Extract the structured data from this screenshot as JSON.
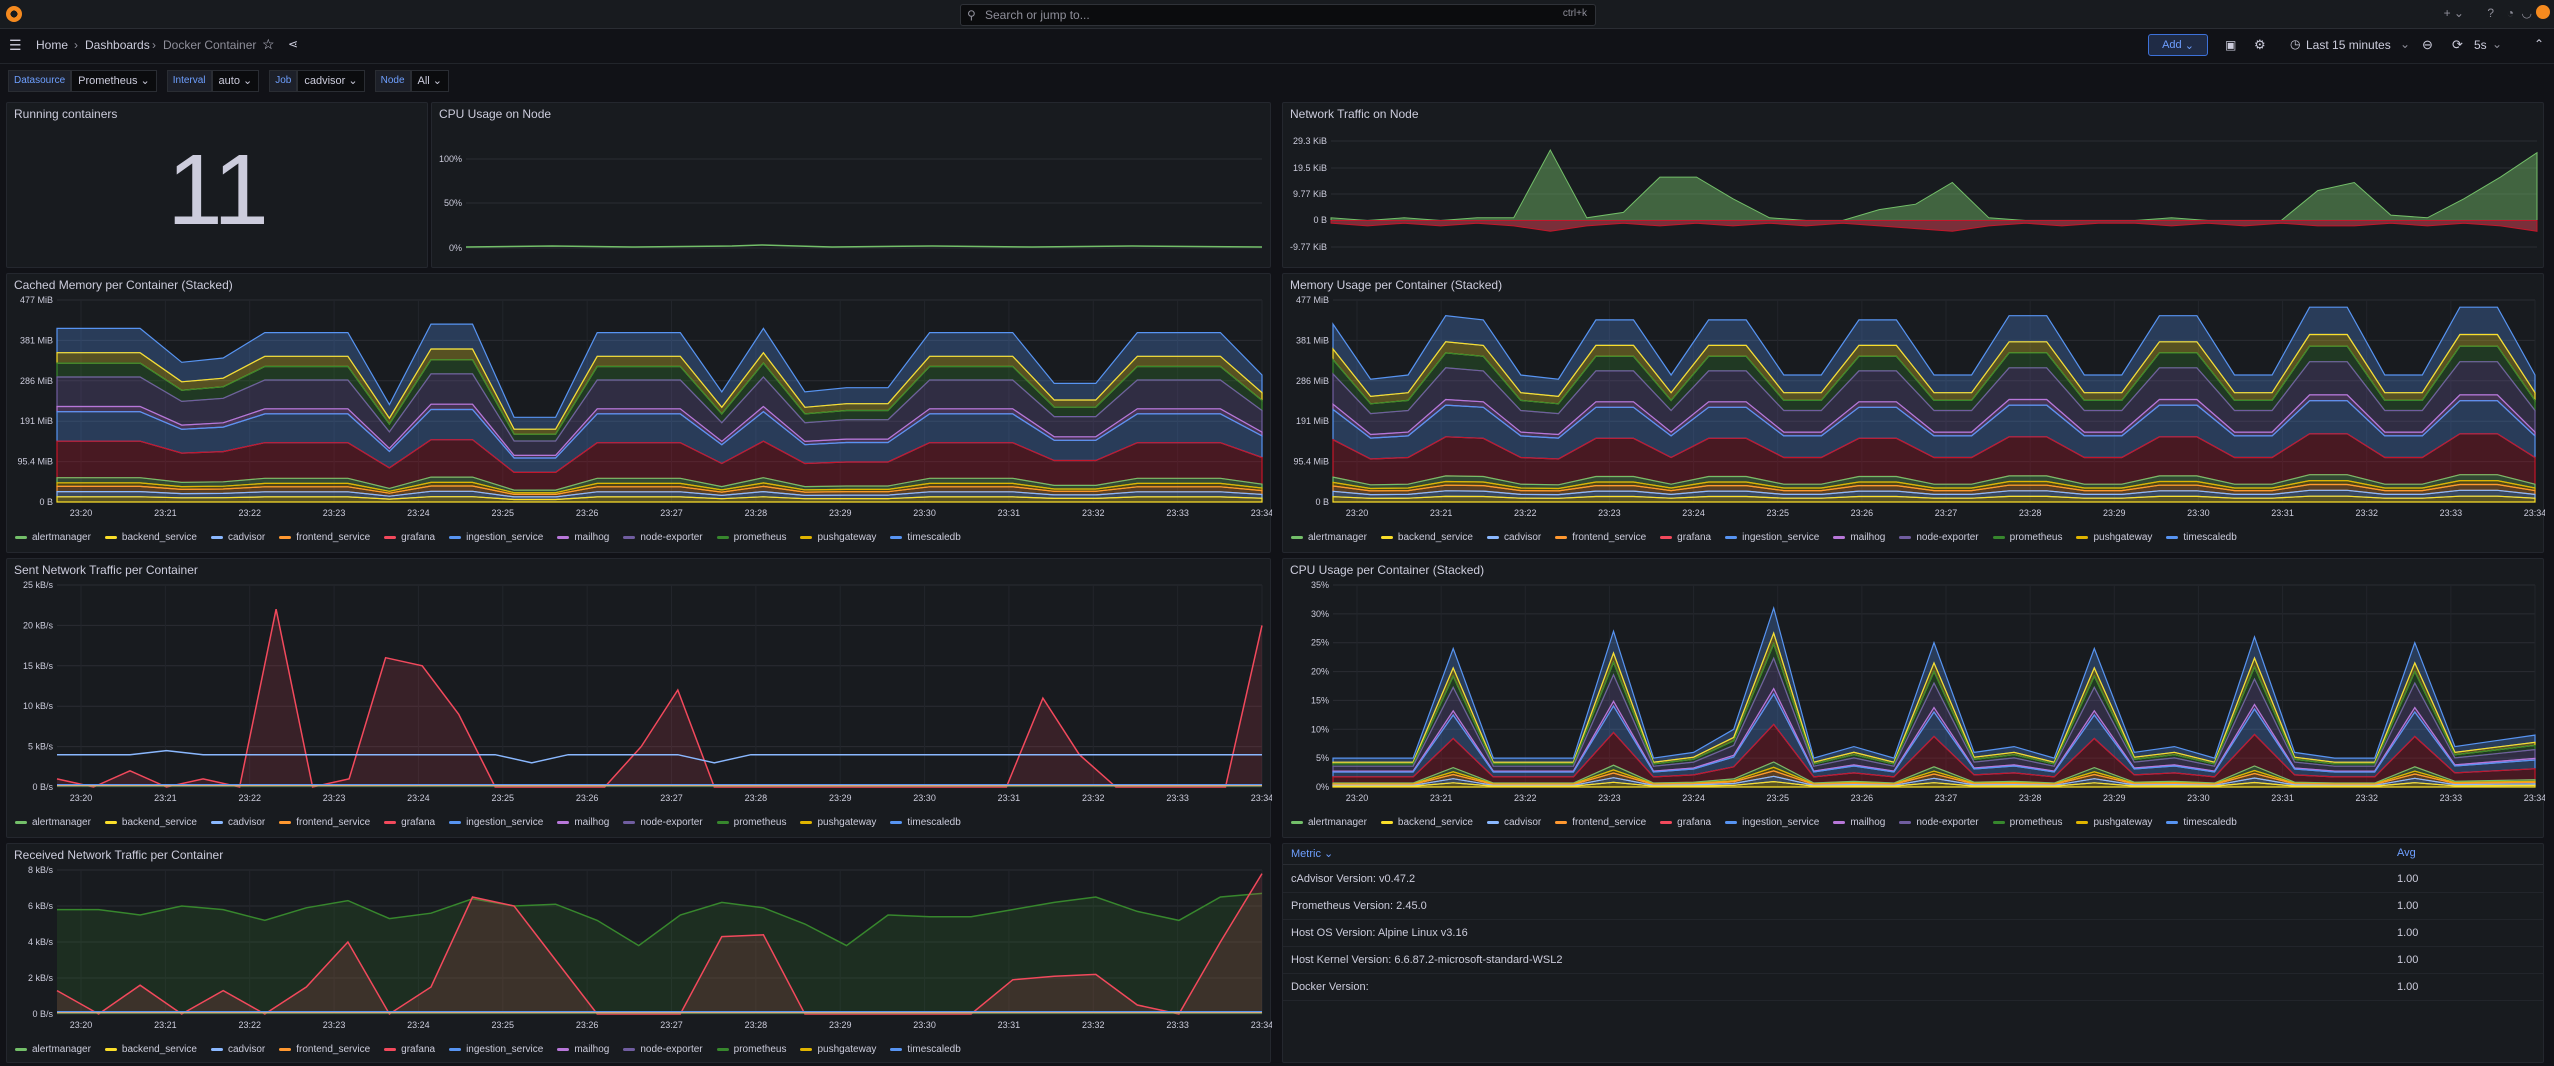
{
  "search": {
    "placeholder": "Search or jump to...",
    "shortcut": "ctrl+k"
  },
  "breadcrumb": [
    "Home",
    "Dashboards",
    "Docker Container"
  ],
  "toolbar": {
    "add_label": "Add",
    "time_range": "Last 15 minutes",
    "refresh": "5s"
  },
  "variables": [
    {
      "label": "Datasource",
      "value": "Prometheus"
    },
    {
      "label": "Interval",
      "value": "auto"
    },
    {
      "label": "Job",
      "value": "cadvisor"
    },
    {
      "label": "Node",
      "value": "All"
    }
  ],
  "legend": [
    {
      "name": "alertmanager",
      "color": "#73bf69"
    },
    {
      "name": "backend_service",
      "color": "#fade2a"
    },
    {
      "name": "cadvisor",
      "color": "#8ab8ff"
    },
    {
      "name": "frontend_service",
      "color": "#ff9830"
    },
    {
      "name": "grafana",
      "color": "#f2495c"
    },
    {
      "name": "ingestion_service",
      "color": "#5794f2"
    },
    {
      "name": "mailhog",
      "color": "#b877d9"
    },
    {
      "name": "node-exporter",
      "color": "#705da0"
    },
    {
      "name": "prometheus",
      "color": "#37872d"
    },
    {
      "name": "pushgateway",
      "color": "#e0b400"
    },
    {
      "name": "timescaledb",
      "color": "#5794f2"
    }
  ],
  "time_ticks": [
    "23:20",
    "23:21",
    "23:22",
    "23:23",
    "23:24",
    "23:25",
    "23:26",
    "23:27",
    "23:28",
    "23:29",
    "23:30",
    "23:31",
    "23:32",
    "23:33",
    "23:34"
  ],
  "panels": {
    "running": {
      "title": "Running containers",
      "value": "11"
    },
    "cpu_node": {
      "title": "CPU Usage on Node",
      "yticks": [
        "100%",
        "50%",
        "0%"
      ]
    },
    "net_node": {
      "title": "Network Traffic on Node",
      "yticks": [
        "29.3 KiB",
        "19.5 KiB",
        "9.77 KiB",
        "0 B",
        "-9.77 KiB"
      ]
    },
    "cached_mem": {
      "title": "Cached Memory per Container (Stacked)",
      "yticks": [
        "477 MiB",
        "381 MiB",
        "286 MiB",
        "191 MiB",
        "95.4 MiB",
        "0 B"
      ]
    },
    "mem_usage": {
      "title": "Memory Usage per Container (Stacked)",
      "yticks": [
        "477 MiB",
        "381 MiB",
        "286 MiB",
        "191 MiB",
        "95.4 MiB",
        "0 B"
      ]
    },
    "sent_net": {
      "title": "Sent Network Traffic per Container",
      "yticks": [
        "25 kB/s",
        "20 kB/s",
        "15 kB/s",
        "10 kB/s",
        "5 kB/s",
        "0 B/s"
      ]
    },
    "cpu_container": {
      "title": "CPU Usage per Container (Stacked)",
      "yticks": [
        "35%",
        "30%",
        "25%",
        "20%",
        "15%",
        "10%",
        "5%",
        "0%"
      ]
    },
    "recv_net": {
      "title": "Received Network Traffic per Container",
      "yticks": [
        "8 kB/s",
        "6 kB/s",
        "4 kB/s",
        "2 kB/s",
        "0 B/s"
      ]
    },
    "versions": {
      "col_metric": "Metric",
      "col_avg": "Avg",
      "rows": [
        {
          "metric": "cAdvisor Version: v0.47.2",
          "avg": "1.00"
        },
        {
          "metric": "Prometheus Version: 2.45.0",
          "avg": "1.00"
        },
        {
          "metric": "Host OS Version: Alpine Linux v3.16",
          "avg": "1.00"
        },
        {
          "metric": "Host Kernel Version: 6.6.87.2-microsoft-standard-WSL2",
          "avg": "1.00"
        },
        {
          "metric": "Docker Version:",
          "avg": "1.00"
        }
      ]
    }
  },
  "chart_data": [
    {
      "type": "line",
      "title": "CPU Usage on Node",
      "ylim": [
        0,
        100
      ],
      "series": [
        {
          "values": [
            1,
            1,
            1,
            1,
            1,
            1,
            1,
            1,
            1,
            1,
            1,
            1,
            1,
            1,
            1
          ]
        }
      ]
    },
    {
      "type": "area",
      "title": "Network Traffic on Node",
      "ylim": [
        -9.77,
        29.3
      ],
      "series": [
        {
          "values": [
            1,
            0,
            1,
            0,
            1,
            1,
            26,
            1,
            3,
            16,
            16,
            8,
            1,
            0,
            0,
            4,
            6,
            14,
            1,
            0,
            0,
            0,
            0,
            1,
            0,
            0,
            0,
            11,
            14,
            2,
            1,
            8,
            16,
            25
          ]
        },
        {
          "values": [
            -1,
            -2,
            -1,
            -2,
            -1,
            -2,
            -4,
            -2,
            -1,
            -2,
            -1,
            -2,
            -1,
            -2,
            -1,
            -2,
            -3,
            -4,
            -2,
            -1,
            -2,
            -1,
            -1,
            -2,
            -1,
            -2,
            -1,
            -2,
            -2,
            -1,
            -2,
            -1,
            -2,
            -4
          ]
        }
      ]
    },
    {
      "type": "area",
      "title": "Cached Memory per Container (Stacked)",
      "ylim": [
        0,
        477
      ],
      "series_totals": [
        410,
        410,
        410,
        330,
        340,
        400,
        400,
        400,
        230,
        420,
        420,
        200,
        200,
        400,
        400,
        400,
        260,
        410,
        260,
        270,
        270,
        400,
        400,
        400,
        280,
        280,
        400,
        400,
        400,
        300
      ]
    },
    {
      "type": "area",
      "title": "Memory Usage per Container (Stacked)",
      "ylim": [
        0,
        477
      ],
      "series_totals": [
        420,
        290,
        300,
        440,
        430,
        300,
        290,
        430,
        430,
        300,
        430,
        430,
        300,
        300,
        430,
        430,
        300,
        300,
        440,
        440,
        300,
        300,
        440,
        440,
        300,
        300,
        460,
        460,
        300,
        300,
        460,
        460,
        300
      ]
    },
    {
      "type": "line",
      "title": "Sent Network Traffic per Container",
      "ylim": [
        0,
        25
      ],
      "series": [
        {
          "name": "grafana",
          "values": [
            1,
            0,
            2,
            0,
            1,
            0,
            22,
            0,
            1,
            16,
            15,
            9,
            0,
            0,
            0,
            0,
            5,
            12,
            0,
            0,
            0,
            0,
            0,
            0,
            0,
            0,
            0,
            11,
            4,
            0,
            0,
            0,
            0,
            20
          ]
        },
        {
          "name": "cadvisor",
          "values": [
            4,
            4,
            4,
            4.5,
            4,
            4,
            4,
            4,
            4,
            4,
            4,
            4,
            4,
            3,
            4,
            4,
            4,
            4,
            3,
            4,
            4,
            4,
            4,
            4,
            4,
            4,
            4,
            4,
            4,
            4,
            4,
            4,
            4,
            4
          ]
        }
      ]
    },
    {
      "type": "area",
      "title": "CPU Usage per Container (Stacked)",
      "ylim": [
        0,
        35
      ],
      "series_totals": [
        5,
        5,
        5,
        24,
        5,
        5,
        5,
        27,
        5,
        6,
        10,
        31,
        5,
        7,
        5,
        25,
        6,
        7,
        5,
        24,
        6,
        7,
        5,
        26,
        6,
        5,
        5,
        25,
        7,
        8,
        9
      ]
    },
    {
      "type": "line",
      "title": "Received Network Traffic per Container",
      "ylim": [
        0,
        8
      ],
      "series": [
        {
          "name": "prometheus",
          "values": [
            5.8,
            5.8,
            5.5,
            6,
            5.8,
            5.2,
            5.9,
            6.3,
            5.3,
            5.6,
            6.4,
            6,
            6.1,
            5.2,
            3.8,
            5.5,
            6.2,
            5.9,
            5,
            3.8,
            5.5,
            5.4,
            5.4,
            5.8,
            6.2,
            6.5,
            5.7,
            5.2,
            6.5,
            6.7
          ]
        },
        {
          "name": "grafana",
          "values": [
            1.3,
            0,
            1.6,
            0,
            1.3,
            0,
            1.5,
            4,
            0,
            1.5,
            6.5,
            6,
            3,
            0,
            0,
            0,
            4.3,
            4.4,
            0,
            0,
            0,
            0,
            0,
            1.9,
            2.1,
            2.2,
            0.5,
            0,
            4,
            7.8
          ]
        }
      ]
    }
  ]
}
